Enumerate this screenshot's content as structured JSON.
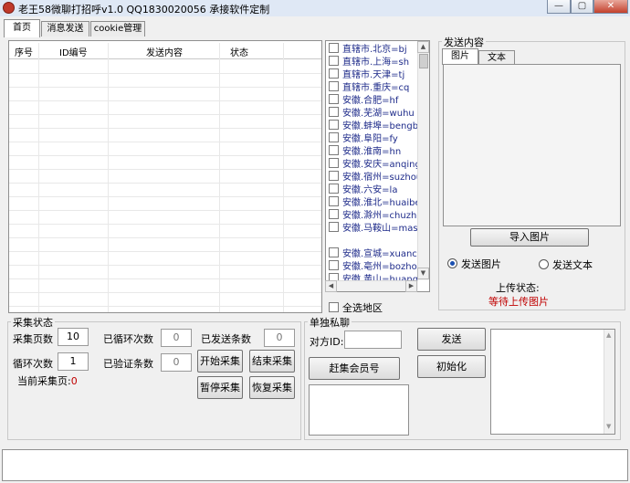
{
  "window": {
    "title": "老王58微聊打招呼v1.0  QQ1830020056 承接软件定制",
    "controls": {
      "minimize": "—",
      "maximize": "▢",
      "close": "✕"
    }
  },
  "tabs": [
    {
      "label": "首页"
    },
    {
      "label": "消息发送"
    },
    {
      "label": "cookie管理"
    }
  ],
  "table": {
    "headers": [
      "序号",
      "ID编号",
      "发送内容",
      "状态"
    ]
  },
  "cities": [
    "直辖市.北京=bj",
    "直辖市.上海=sh",
    "直辖市.天津=tj",
    "直辖市.重庆=cq",
    "安徽.合肥=hf",
    "安徽.芜湖=wuhu",
    "安徽.蚌埠=bengbu",
    "安徽.阜阳=fy",
    "安徽.淮南=hn",
    "安徽.安庆=anqing",
    "安徽.宿州=suzhou",
    "安徽.六安=la",
    "安徽.淮北=huaibei",
    "安徽.滁州=chuzhou",
    "安徽.马鞍山=mas",
    "",
    "安徽.宣城=xuancheng",
    "安徽.亳州=bozhou",
    "安徽.黄山=huangshan"
  ],
  "select_all_label": "全选地区",
  "send_content": {
    "group_label": "发送内容",
    "tabs": [
      {
        "label": "图片"
      },
      {
        "label": "文本"
      }
    ],
    "import_button": "导入图片",
    "radio_image": "发送图片",
    "radio_text": "发送文本",
    "upload_status_label": "上传状态:",
    "upload_status_value": "等待上传图片",
    "status_color": "#c00000"
  },
  "collect": {
    "group_label": "采集状态",
    "pages_label": "采集页数",
    "pages_value": "10",
    "loops_label": "循环次数",
    "loops_value": "1",
    "current_page_label": "当前采集页:",
    "current_page_value": "0",
    "looped_label": "已循环次数",
    "looped_value": "0",
    "verified_label": "已验证条数",
    "verified_value": "0",
    "sent_label": "已发送条数",
    "sent_value": "0",
    "start_button": "开始采集",
    "stop_button": "结束采集",
    "pause_button": "暂停采集",
    "resume_button": "恢复采集"
  },
  "private_chat": {
    "group_label": "单独私聊",
    "target_label": "对方ID:",
    "target_value": "",
    "collect_member_button": "赶集会员号",
    "send_button": "发送",
    "init_button": "初始化"
  }
}
